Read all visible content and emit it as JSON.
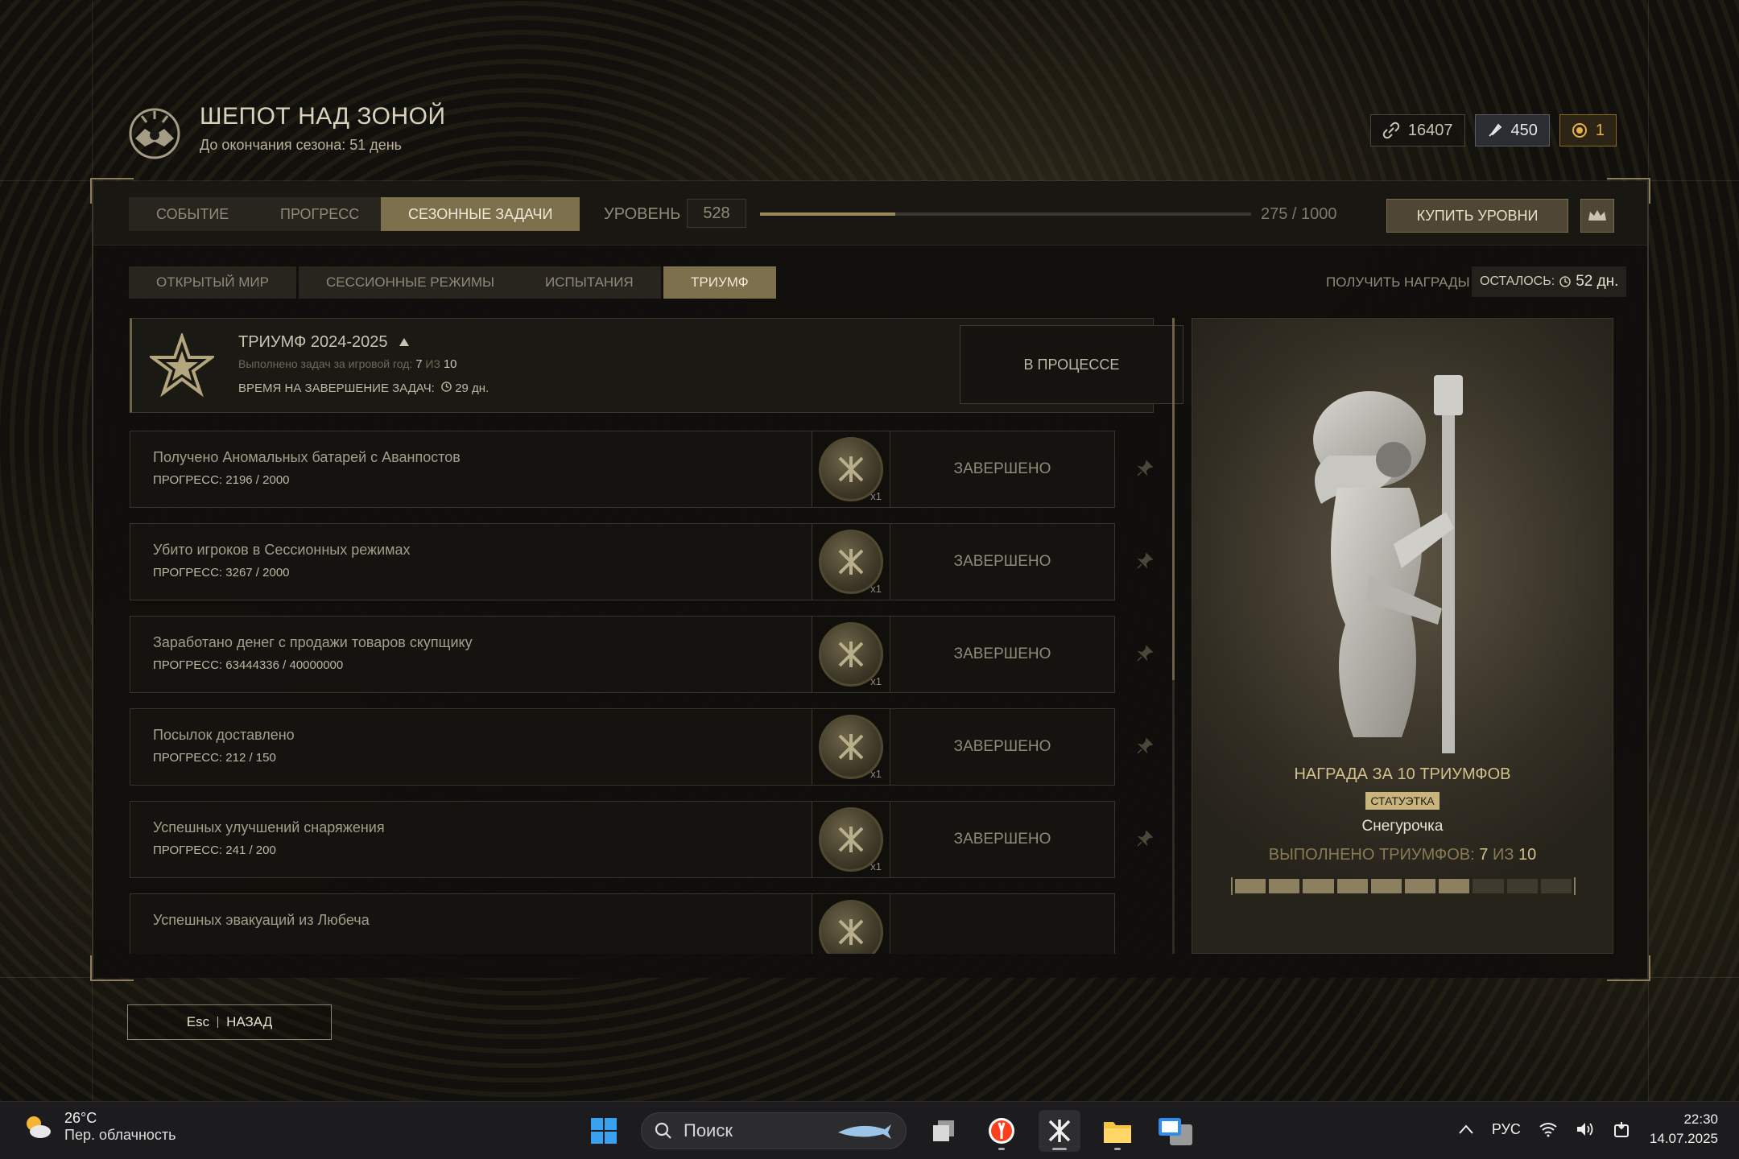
{
  "header": {
    "title": "ШЕПОТ НАД ЗОНОЙ",
    "subtitle": "До окончания сезона: 51 день",
    "currencies": [
      {
        "icon": "link-icon",
        "value": "16407"
      },
      {
        "icon": "feather-icon",
        "value": "450"
      },
      {
        "icon": "coin-icon",
        "value": "1"
      }
    ]
  },
  "top_tabs": [
    {
      "label": "СОБЫТИЕ",
      "active": false
    },
    {
      "label": "ПРОГРЕСС",
      "active": false
    },
    {
      "label": "СЕЗОННЫЕ ЗАДАЧИ",
      "active": true
    }
  ],
  "level": {
    "label": "УРОВЕНЬ",
    "value": "528",
    "progress_text": "275 / 1000",
    "progress_fraction": 0.275,
    "buy_label": "КУПИТЬ УРОВНИ"
  },
  "sub_tabs": [
    {
      "label": "ОТКРЫТЫЙ МИР",
      "active": false
    },
    {
      "label": "СЕССИОННЫЕ РЕЖИМЫ",
      "active": false
    },
    {
      "label": "ИСПЫТАНИЯ",
      "active": false
    },
    {
      "label": "ТРИУМФ",
      "active": true
    }
  ],
  "rewards": {
    "label": "ПОЛУЧИТЬ НАГРАДЫ",
    "remain_label": "ОСТАЛОСЬ:",
    "remain_value": "52 дн."
  },
  "triumph": {
    "title": "ТРИУМФ 2024-2025",
    "done_label": "Выполнено задач за игровой год:",
    "done_value": "7",
    "of": "ИЗ",
    "total": "10",
    "time_label": "ВРЕМЯ НА ЗАВЕРШЕНИЕ ЗАДАЧ:",
    "time_value": "29 дн.",
    "status": "В ПРОЦЕССЕ"
  },
  "tasks": [
    {
      "name": "Получено Аномальных батарей с Аванпостов",
      "progress": "ПРОГРЕСС: 2196 / 2000",
      "reward_count": "x1",
      "status": "ЗАВЕРШЕНО"
    },
    {
      "name": "Убито игроков в Сессионных режимах",
      "progress": "ПРОГРЕСС: 3267 / 2000",
      "reward_count": "x1",
      "status": "ЗАВЕРШЕНО"
    },
    {
      "name": "Заработано денег с продажи товаров скупщику",
      "progress": "ПРОГРЕСС: 63444336 / 40000000",
      "reward_count": "x1",
      "status": "ЗАВЕРШЕНО"
    },
    {
      "name": "Посылок доставлено",
      "progress": "ПРОГРЕСС: 212 / 150",
      "reward_count": "x1",
      "status": "ЗАВЕРШЕНО"
    },
    {
      "name": "Успешных улучшений снаряжения",
      "progress": "ПРОГРЕСС: 241 / 200",
      "reward_count": "x1",
      "status": "ЗАВЕРШЕНО"
    },
    {
      "name": "Успешных эвакуаций из Любеча",
      "progress": "",
      "reward_count": "",
      "status": ""
    }
  ],
  "reward_panel": {
    "title": "НАГРАДА ЗА 10 ТРИУМФОВ",
    "badge": "СТАТУЭТКА",
    "name": "Снегурочка",
    "count_label": "ВЫПОЛНЕНО ТРИУМФОВ:",
    "count_done": "7",
    "count_of": "ИЗ",
    "count_total": "10",
    "segments_filled": 7,
    "segments_total": 10
  },
  "back": {
    "key": "Esc",
    "label": "НАЗАД"
  },
  "taskbar": {
    "weather_temp": "26°C",
    "weather_text": "Пер. облачность",
    "search_placeholder": "Поиск",
    "lang": "РУС",
    "time": "22:30",
    "date": "14.07.2025"
  }
}
